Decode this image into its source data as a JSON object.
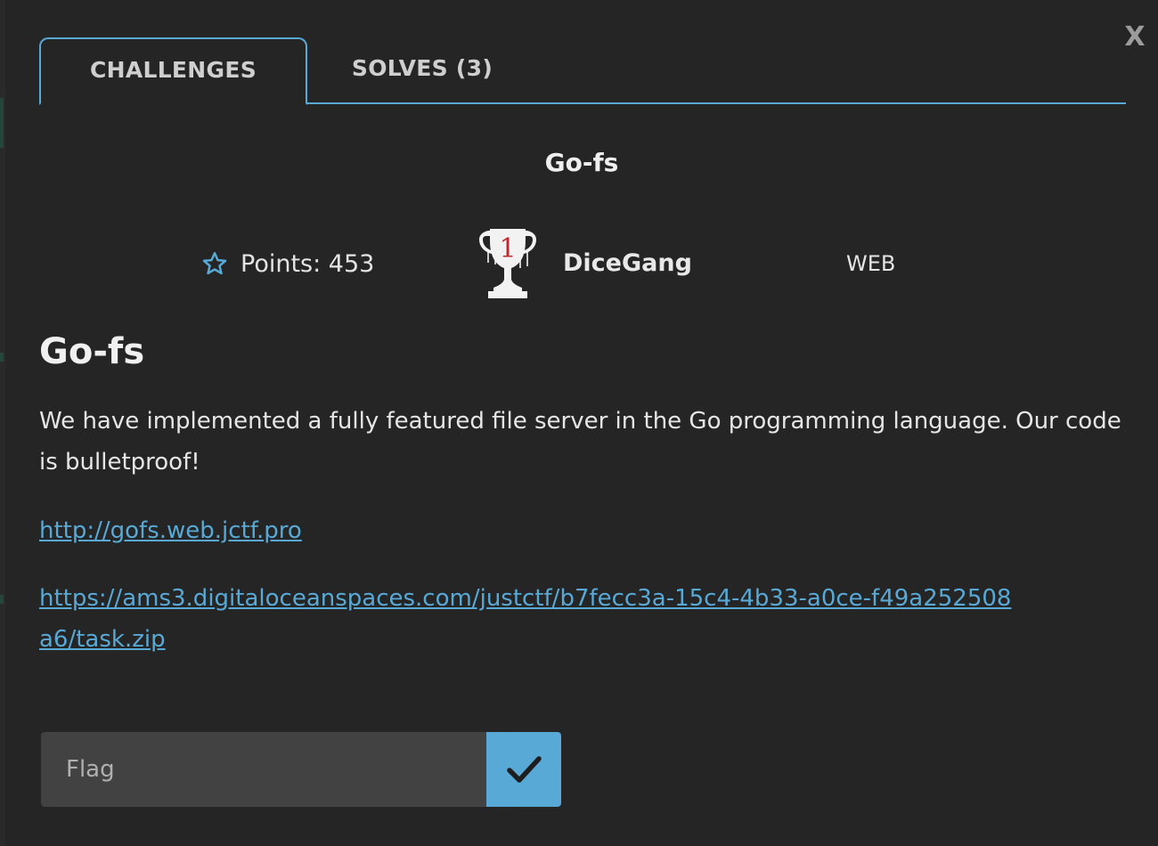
{
  "modal": {
    "close_label": "X",
    "tabs": [
      {
        "label": "CHALLENGES",
        "active": true
      },
      {
        "label": "SOLVES (3)",
        "active": false
      }
    ]
  },
  "challenge": {
    "name": "Go-fs",
    "points_label": "Points: 453",
    "first_blood": {
      "rank": "1",
      "team": "DiceGang"
    },
    "category": "WEB",
    "description": {
      "heading": "Go-fs",
      "text": "We have implemented a fully featured file server in the Go programming language. Our code is bulletproof!",
      "links": [
        "http://gofs.web.jctf.pro",
        "https://ams3.digitaloceanspaces.com/justctf/b7fecc3a-15c4-4b33-a0ce-f49a252508a6/task.zip"
      ]
    }
  },
  "flag_form": {
    "placeholder": "Flag",
    "submit_icon": "check-icon"
  },
  "colors": {
    "accent": "#58a9d5",
    "background": "#252525",
    "input_bg": "#424242"
  }
}
